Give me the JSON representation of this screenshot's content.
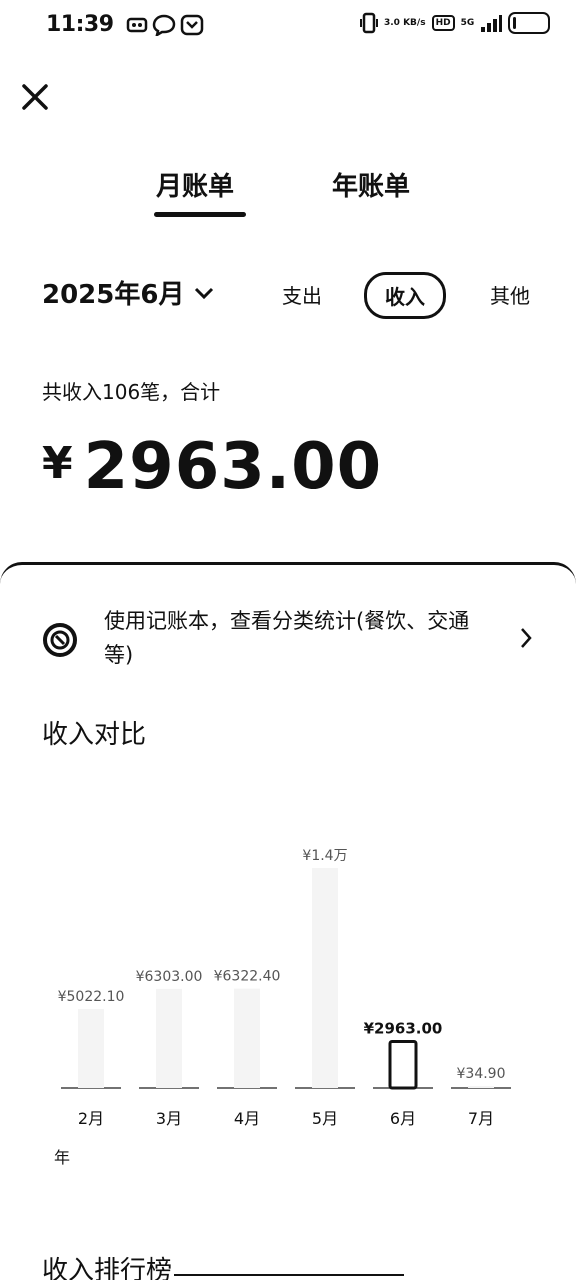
{
  "status": {
    "time": "11:39",
    "speed": "3.0 KB/s",
    "hd": "HD",
    "signal_label": "5G",
    "battery_percent": 10
  },
  "tabs": {
    "month": "月账单",
    "year": "年账单"
  },
  "period": "2025年6月",
  "filters": {
    "expense": "支出",
    "income": "收入",
    "other": "其他"
  },
  "summary": "共收入106笔，合计",
  "total": {
    "currency": "¥",
    "amount": "2963.00"
  },
  "promo": {
    "text": "使用记账本，查看分类统计(餐饮、交通等)"
  },
  "compare_title": "收入对比",
  "year_label": "年",
  "rank_title": "收入排行榜",
  "chart_data": {
    "type": "bar",
    "categories": [
      "2月",
      "3月",
      "4月",
      "5月",
      "6月",
      "7月"
    ],
    "values": [
      5022.1,
      6303.0,
      6322.4,
      14000,
      2963.0,
      34.9
    ],
    "value_labels": [
      "¥5022.10",
      "¥6303.00",
      "¥6322.40",
      "¥1.4万",
      "¥2963.00",
      "¥34.90"
    ],
    "highlight_index": 4,
    "title": "",
    "xlabel": "",
    "ylabel": ""
  }
}
